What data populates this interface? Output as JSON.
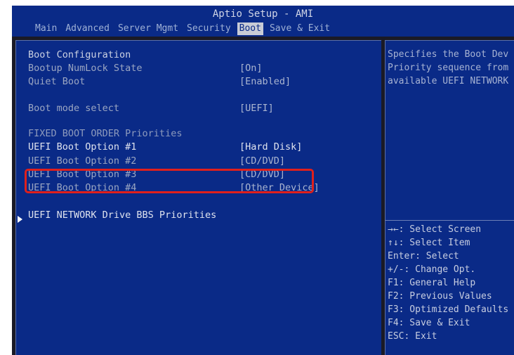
{
  "header": {
    "title": "Aptio Setup - AMI",
    "tabs": [
      "Main",
      "Advanced",
      "Server Mgmt",
      "Security",
      "Boot",
      "Save & Exit"
    ],
    "active_tab": "Boot"
  },
  "settings": {
    "section_heading": "Boot Configuration",
    "numlock_label": "Bootup NumLock State",
    "numlock_value": "[On]",
    "quiet_boot_label": "Quiet Boot",
    "quiet_boot_value": "[Enabled]",
    "boot_mode_label": "Boot mode select",
    "boot_mode_value": "[UEFI]",
    "fixed_order_heading": "FIXED BOOT ORDER Priorities",
    "options": [
      {
        "label": "UEFI Boot Option #1",
        "value": "[Hard Disk]"
      },
      {
        "label": "UEFI Boot Option #2",
        "value": "[CD/DVD]"
      },
      {
        "label": "UEFI Boot Option #3",
        "value": "[CD/DVD]"
      },
      {
        "label": "UEFI Boot Option #4",
        "value": "[Other Device]"
      }
    ],
    "network_drive_label": "UEFI NETWORK Drive BBS Priorities"
  },
  "help_panel": {
    "lines": [
      "Specifies the Boot Dev",
      "Priority sequence from",
      "available UEFI NETWORK"
    ]
  },
  "keys": [
    "→←: Select Screen",
    "↑↓: Select Item",
    "Enter: Select",
    "+/-: Change Opt.",
    "F1: General Help",
    "F2: Previous Values",
    "F3: Optimized Defaults",
    "F4: Save & Exit",
    "ESC: Exit"
  ],
  "colors": {
    "bios_blue": "#0a2a87",
    "highlight_red": "#e0201c"
  }
}
